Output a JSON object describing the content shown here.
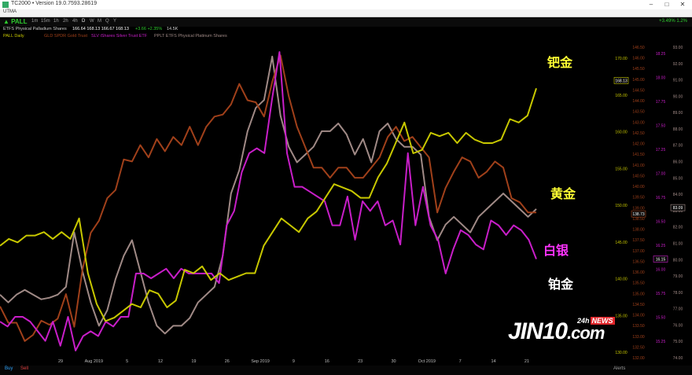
{
  "window": {
    "title": "TC2000 • Version 19.0.7593.28619",
    "menu": "UTMA"
  },
  "toolbar": {
    "symbol": "PALL",
    "buttons": [
      "1m",
      "15m",
      "1h",
      "2h",
      "4h",
      "D",
      "W",
      "M",
      "Q",
      "Y"
    ],
    "performance": "+3.49% 1.2%"
  },
  "quote": {
    "name": "ETFS Physical Palladium Shares",
    "prices": "166.64  168.13  166.67  168.13",
    "change": "+3.66  +2.35%",
    "volume": "14.5K"
  },
  "legend": [
    {
      "label": "PALL Daily",
      "color": "#c8c800"
    },
    {
      "label": "GLD SPDR Gold Trust",
      "color": "#a0401a"
    },
    {
      "label": "SLV iShares Silver Trust ETF",
      "color": "#c81ec8"
    },
    {
      "label": "PPLT ETFS Physical Platinum Shares",
      "color": "#a08a86"
    }
  ],
  "annotations": {
    "palladium": "钯金",
    "gold": "黄金",
    "silver": "白银",
    "platinum": "铂金"
  },
  "logo": {
    "main": "JIN10",
    "dotcom": ".com",
    "prefix": "24h",
    "news": "NEWS"
  },
  "bottom_tabs": [
    "Buy",
    "Sell",
    "Alerts"
  ],
  "colors": {
    "background": "#000000",
    "palladium": "#c8c800",
    "gold": "#a0401a",
    "silver": "#c81ec8",
    "platinum": "#a08a86",
    "palladium_label": "#ffff33",
    "gold_label": "#ffff33",
    "silver_label": "#ff33ff",
    "platinum_label": "#ffffff"
  },
  "chart_data": {
    "type": "line",
    "x_tick_labels": [
      "29",
      "Aug 2019",
      "5",
      "12",
      "19",
      "26",
      "Sep 2019",
      "9",
      "16",
      "23",
      "30",
      "Oct 2019",
      "7",
      "14",
      "21"
    ],
    "axes": {
      "pall": {
        "ticks": [
          "170.00",
          "165.00",
          "160.00",
          "155.00",
          "150.00",
          "145.00",
          "140.00",
          "135.00",
          "130.00"
        ],
        "ylim": [
          128,
          173
        ],
        "last": "168.13",
        "color": "#c8c800"
      },
      "gld": {
        "ticks": [
          "146.50",
          "146.00",
          "145.50",
          "145.00",
          "144.50",
          "144.00",
          "143.50",
          "143.00",
          "142.50",
          "142.00",
          "141.50",
          "141.00",
          "140.50",
          "140.00",
          "139.50",
          "139.00",
          "138.50",
          "138.00",
          "137.50",
          "137.00",
          "136.50",
          "136.00",
          "135.50",
          "135.00",
          "134.50",
          "134.00",
          "133.50",
          "133.00",
          "132.50",
          "132.00"
        ],
        "ylim": [
          131.8,
          146.9
        ],
        "last": "138.73",
        "color": "#a0401a"
      },
      "slv": {
        "ticks": [
          "18.25",
          "18.00",
          "17.75",
          "17.50",
          "17.25",
          "17.00",
          "16.75",
          "16.50",
          "16.25",
          "16.00",
          "15.75",
          "15.50",
          "15.25"
        ],
        "ylim": [
          15.15,
          18.35
        ],
        "last": "16.15",
        "color": "#c81ec8"
      },
      "pplt": {
        "ticks": [
          "93.00",
          "92.00",
          "91.00",
          "90.00",
          "89.00",
          "88.00",
          "87.00",
          "86.00",
          "85.00",
          "84.00",
          "83.00",
          "82.00",
          "81.00",
          "80.00",
          "79.00",
          "78.00",
          "77.00",
          "76.00",
          "75.00",
          "74.00"
        ],
        "ylim": [
          73.6,
          93.4
        ],
        "last": "83.09",
        "color": "#a08a86"
      }
    },
    "series": [
      {
        "name": "PALL Daily",
        "axis": "pall",
        "values": [
          144.0,
          145.0,
          144.5,
          145.5,
          145.5,
          146.0,
          145.0,
          146.0,
          145.0,
          148.0,
          140.0,
          135.5,
          133.0,
          133.5,
          134.5,
          135.5,
          135.0,
          137.5,
          137.0,
          135.0,
          136.0,
          140.5,
          140.0,
          141.0,
          139.0,
          140.0,
          139.0,
          139.5,
          140.0,
          140.0,
          144.0,
          146.0,
          148.0,
          147.0,
          146.0,
          148.0,
          149.0,
          151.0,
          153.0,
          152.5,
          152.0,
          151.0,
          151.0,
          154.0,
          156.0,
          159.0,
          162.0,
          157.5,
          158.0,
          160.5,
          160.0,
          160.5,
          159.0,
          160.5,
          159.5,
          159.0,
          159.0,
          159.5,
          162.5,
          162.0,
          163.0,
          167.0
        ]
      },
      {
        "name": "GLD SPDR Gold Trust",
        "axis": "gld",
        "values": [
          134.2,
          133.4,
          133.4,
          132.5,
          132.8,
          133.5,
          133.3,
          133.6,
          134.8,
          133.2,
          136.0,
          137.8,
          138.4,
          139.5,
          139.9,
          141.4,
          141.3,
          142.1,
          141.5,
          142.4,
          141.8,
          142.5,
          142.1,
          143.0,
          142.1,
          143.0,
          143.5,
          143.6,
          144.1,
          145.1,
          144.3,
          144.2,
          143.5,
          145.2,
          146.5,
          144.5,
          143.0,
          142.0,
          141.0,
          141.0,
          140.5,
          141.0,
          141.0,
          140.5,
          140.5,
          141.0,
          141.5,
          142.5,
          143.0,
          142.3,
          142.5,
          142.0,
          141.5,
          138.8,
          140.0,
          140.8,
          141.5,
          141.3,
          140.5,
          140.8,
          141.3,
          141.0,
          139.5,
          139.3,
          138.8,
          138.8
        ]
      },
      {
        "name": "SLV iShares Silver Trust ETF",
        "axis": "slv",
        "values": [
          15.5,
          15.45,
          15.55,
          15.55,
          15.5,
          15.4,
          15.3,
          15.5,
          15.25,
          15.55,
          15.2,
          15.35,
          15.4,
          15.35,
          15.5,
          15.45,
          15.55,
          15.55,
          16.0,
          16.0,
          15.95,
          16.0,
          16.05,
          15.95,
          16.05,
          16.0,
          16.0,
          16.0,
          16.0,
          15.9,
          16.5,
          16.65,
          17.05,
          17.25,
          17.3,
          17.25,
          17.8,
          18.3,
          17.25,
          16.9,
          16.9,
          16.85,
          16.8,
          16.75,
          16.5,
          16.5,
          16.8,
          16.35,
          16.75,
          16.65,
          16.75,
          16.5,
          16.55,
          16.3,
          17.25,
          16.5,
          16.9,
          16.5,
          16.35,
          16.0,
          16.25,
          16.45,
          16.4,
          16.3,
          16.25,
          16.55,
          16.5,
          16.4,
          16.5,
          16.45,
          16.35,
          16.15
        ]
      },
      {
        "name": "PPLT ETFS Physical Platinum Shares",
        "axis": "pplt",
        "values": [
          77.5,
          77.0,
          77.5,
          77.8,
          77.5,
          77.2,
          77.3,
          77.5,
          78.0,
          81.5,
          79.0,
          77.0,
          75.5,
          76.5,
          78.5,
          80.0,
          81.0,
          79.0,
          77.0,
          75.5,
          75.0,
          75.5,
          75.5,
          76.0,
          77.0,
          77.5,
          78.0,
          80.0,
          84.0,
          85.5,
          88.0,
          89.5,
          90.0,
          92.8,
          89.0,
          87.0,
          86.0,
          86.5,
          87.0,
          88.0,
          88.0,
          88.5,
          87.8,
          86.5,
          87.5,
          86.0,
          88.0,
          88.5,
          87.5,
          87.0,
          87.0,
          86.5,
          82.5,
          81.0,
          82.0,
          82.5,
          82.0,
          81.5,
          82.5,
          83.0,
          83.5,
          84.0,
          83.5,
          83.0,
          82.5,
          83.0
        ]
      }
    ]
  }
}
